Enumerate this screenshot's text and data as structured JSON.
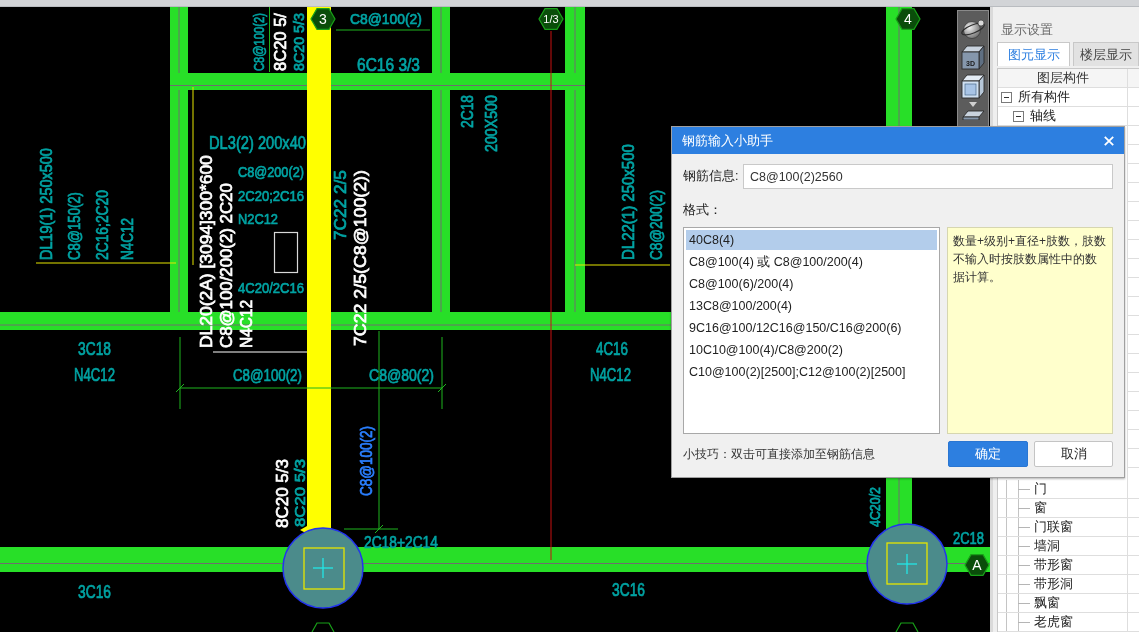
{
  "cad": {
    "axis_bubbles": [
      {
        "label": "3"
      },
      {
        "label": "1/3"
      },
      {
        "label": "4"
      },
      {
        "label": "A"
      }
    ],
    "annotations": [
      {
        "text": "C8@100(2)",
        "color": "#00a3a3"
      },
      {
        "text": "8C20 5/",
        "color": "#ffffff"
      },
      {
        "text": "8C20 5/3",
        "color": "#00a3a3"
      },
      {
        "text": "C8@100(2)",
        "color": "#00a3a3"
      },
      {
        "text": "6C16 3/3",
        "color": "#00a3a3"
      },
      {
        "text": "2C18",
        "color": "#00a3a3"
      },
      {
        "text": "200X500",
        "color": "#00a3a3"
      },
      {
        "text": "DL3(2) 200x40",
        "color": "#00a3a3"
      },
      {
        "text": "DL19(1) 250x500",
        "color": "#00a3a3"
      },
      {
        "text": "C8@150(2)",
        "color": "#00a3a3"
      },
      {
        "text": "2C16;2C20",
        "color": "#00a3a3"
      },
      {
        "text": "N4C12",
        "color": "#00a3a3"
      },
      {
        "text": "DL22(1) 250x500",
        "color": "#00a3a3"
      },
      {
        "text": "C8@200(2)",
        "color": "#00a3a3"
      },
      {
        "text": "C8@200(2)",
        "color": "#00a3a3"
      },
      {
        "text": "2C20;2C16",
        "color": "#00a3a3"
      },
      {
        "text": "N2C12",
        "color": "#00a3a3"
      },
      {
        "text": "7C22 2/5",
        "color": "#00a3a3"
      },
      {
        "text": "4C20/2C16",
        "color": "#00a3a3"
      },
      {
        "text": "DL20(2A) [3094]300*600",
        "color": "#ffffff"
      },
      {
        "text": "C8@100/200(2) 2C20",
        "color": "#ffffff"
      },
      {
        "text": "N4C12",
        "color": "#ffffff"
      },
      {
        "text": "7C22 2/5(C8@100(2))",
        "color": "#ffffff"
      },
      {
        "text": "3C18",
        "color": "#00a3a3"
      },
      {
        "text": "4C16",
        "color": "#00a3a3"
      },
      {
        "text": "N4C12",
        "color": "#00a3a3"
      },
      {
        "text": "C8@100(2)",
        "color": "#00a3a3"
      },
      {
        "text": "C8@80(2)",
        "color": "#00a3a3"
      },
      {
        "text": "N4C12",
        "color": "#00a3a3"
      },
      {
        "text": "C8@100(2)",
        "color": "#2a7fff"
      },
      {
        "text": "8C20 5/3",
        "color": "#ffffff"
      },
      {
        "text": "8C20 5/3",
        "color": "#00a3a3"
      },
      {
        "text": "4C20/2",
        "color": "#00a3a3"
      },
      {
        "text": "2C18+2C14",
        "color": "#00a3a3"
      },
      {
        "text": "2C18",
        "color": "#00a3a3"
      },
      {
        "text": "3C16",
        "color": "#00a3a3"
      },
      {
        "text": "3C16",
        "color": "#00a3a3"
      }
    ]
  },
  "view_toolbar": {
    "cube_label": "3D"
  },
  "display_panel": {
    "title": "显示设置",
    "tabs": [
      {
        "label": "图元显示",
        "selected": true
      },
      {
        "label": "楼层显示",
        "selected": false
      }
    ],
    "column_header": "图层构件",
    "tree": [
      {
        "label": "所有构件",
        "expanded": true,
        "children": [
          {
            "label": "轴线",
            "expanded": true
          }
        ]
      }
    ],
    "tree_continued": [
      {
        "label": "门"
      },
      {
        "label": "窗"
      },
      {
        "label": "门联窗"
      },
      {
        "label": "墙洞"
      },
      {
        "label": "带形窗"
      },
      {
        "label": "带形洞"
      },
      {
        "label": "飘窗"
      },
      {
        "label": "老虎窗"
      }
    ]
  },
  "dialog": {
    "title": "钢筋输入小助手",
    "field_label": "钢筋信息:",
    "field_value": "C8@100(2)2560",
    "format_label": "格式：",
    "formats": [
      {
        "text": "40C8(4)",
        "selected": true
      },
      {
        "text": "C8@100(4) 或 C8@100/200(4)",
        "selected": false
      },
      {
        "text": "C8@100(6)/200(4)",
        "selected": false
      },
      {
        "text": "13C8@100/200(4)",
        "selected": false
      },
      {
        "text": "9C16@100/12C16@150/C16@200(6)",
        "selected": false
      },
      {
        "text": "10C10@100(4)/C8@200(2)",
        "selected": false
      },
      {
        "text": "C10@100(2)[2500];C12@100(2)[2500]",
        "selected": false
      }
    ],
    "description": "数量+级别+直径+肢数，肢数不输入时按肢数属性中的数据计算。",
    "tip": "小技巧：双击可直接添加至钢筋信息",
    "buttons": [
      {
        "label": "确定",
        "kind": "primary"
      },
      {
        "label": "取消",
        "kind": "default"
      }
    ]
  }
}
